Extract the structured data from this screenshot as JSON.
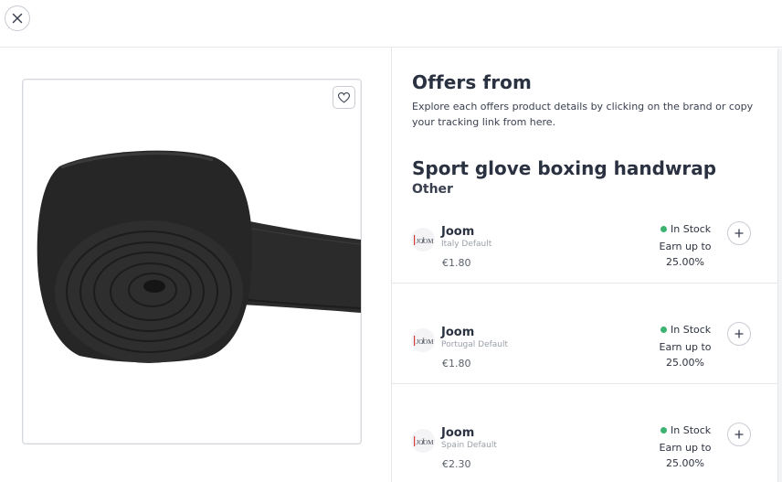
{
  "header": {
    "close_icon": "close-icon"
  },
  "product": {
    "title": "Sport glove boxing handwrap",
    "category": "Other",
    "image_alt": "Black boxing handwrap roll",
    "favorite_icon": "heart-icon"
  },
  "offers_section": {
    "title": "Offers from",
    "description": "Explore each offers product details by clicking on the brand or copy your tracking link from here."
  },
  "offers": [
    {
      "brand": "Joom",
      "store": "Italy Default",
      "price": "€1.80",
      "stock": "In Stock",
      "earn_line1": "Earn up to",
      "earn_line2": "25.00%"
    },
    {
      "brand": "Joom",
      "store": "Portugal Default",
      "price": "€1.80",
      "stock": "In Stock",
      "earn_line1": "Earn up to",
      "earn_line2": "25.00%"
    },
    {
      "brand": "Joom",
      "store": "Spain Default",
      "price": "€2.30",
      "stock": "In Stock",
      "earn_line1": "Earn up to",
      "earn_line2": "25.00%"
    }
  ],
  "colors": {
    "in_stock": "#3cb371",
    "text_dark": "#2a3140",
    "border": "#e4e6ea"
  }
}
